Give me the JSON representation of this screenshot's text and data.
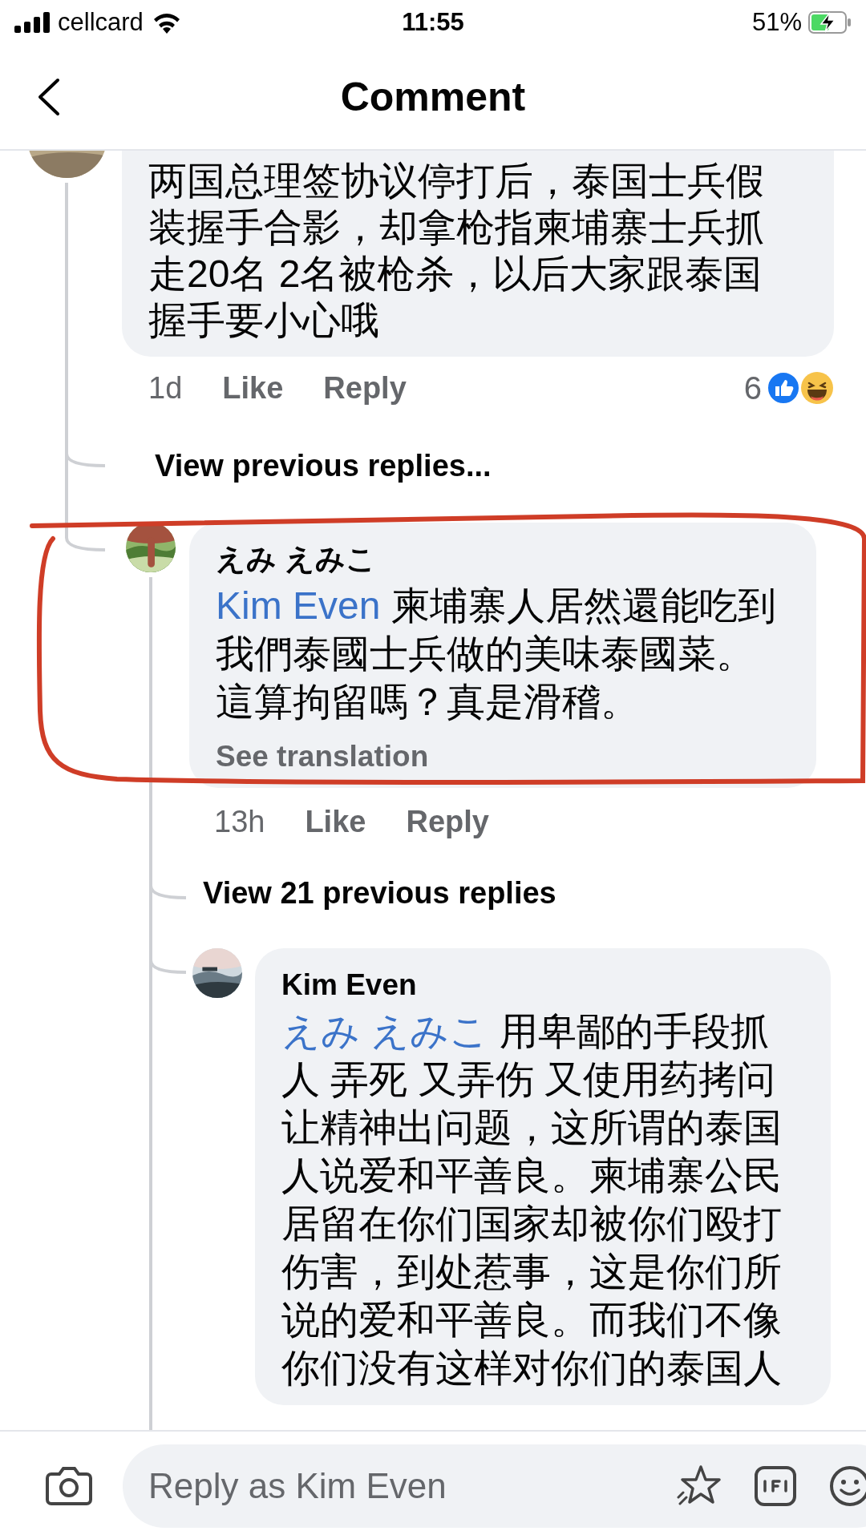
{
  "status_bar": {
    "carrier": "cellcard",
    "time": "11:55",
    "battery": "51%",
    "charging": true
  },
  "header": {
    "title": "Comment"
  },
  "comments": [
    {
      "lines": [
        "两国总理签协议停打后，泰国士兵假",
        "装握手合影，却拿枪指柬埔寨士兵抓",
        "走20名 2名被枪杀，以后大家跟泰国",
        "握手要小心哦"
      ],
      "time": "1d",
      "actions": [
        "Like",
        "Reply"
      ],
      "reactions": {
        "count": "6"
      },
      "highlighted": false,
      "children": [
        {
          "kind": "view_more",
          "label": "View previous replies..."
        },
        {
          "kind": "comment",
          "author": "えみ えみこ",
          "mention": "Kim Even",
          "lines": [
            "柬埔寨人居然還能吃到",
            "我們泰國士兵做的美味泰國菜。",
            "這算拘留嗎？真是滑稽。"
          ],
          "see_translation": "See translation",
          "time": "13h",
          "actions": [
            "Like",
            "Reply"
          ],
          "highlighted": true,
          "children": [
            {
              "kind": "view_more",
              "label": "View 21 previous replies"
            },
            {
              "kind": "comment",
              "author": "Kim Even",
              "mention": "えみ えみこ",
              "lines": [
                "用卑鄙的手段抓",
                "人 弄死 又弄伤 又使用药拷问",
                "让精神出问题，这所谓的泰国",
                "人说爱和平善良。柬埔寨公民",
                "居留在你们国家却被你们殴打",
                "伤害，到处惹事，这是你们所",
                "说的爱和平善良。而我们不像",
                "你们没有这样对你们的泰国人"
              ],
              "highlighted": false
            }
          ]
        }
      ]
    }
  ],
  "composer": {
    "placeholder": "Reply as Kim Even"
  }
}
